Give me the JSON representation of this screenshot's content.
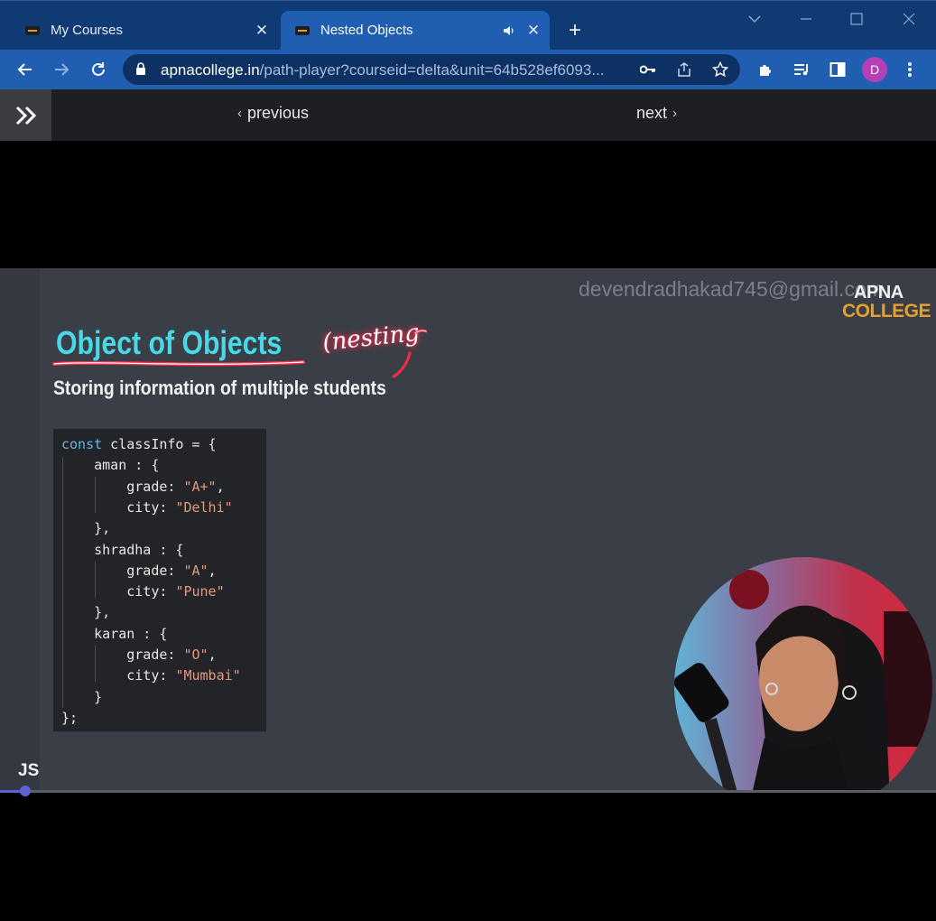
{
  "browser": {
    "tabs": [
      {
        "title": "My Courses",
        "active": false
      },
      {
        "title": "Nested Objects",
        "active": true
      }
    ],
    "url_host": "apnacollege.in",
    "url_rest": "/path-player?courseid=delta&unit=64b528ef6093...",
    "profile_initial": "D"
  },
  "nav": {
    "previous_label": "previous",
    "next_label": "next"
  },
  "slide": {
    "watermark": "devendradhakad745@gmail.com",
    "logo_top": "APNA",
    "logo_bottom": "COLLEGE",
    "title": "Object of Objects",
    "annotation": "(nesting",
    "subtitle": "Storing information of multiple students",
    "code_lines": [
      [
        {
          "t": "kw",
          "v": "const"
        },
        {
          "t": "p",
          "v": " classInfo = {"
        }
      ],
      [
        {
          "t": "p",
          "v": "    aman : {"
        }
      ],
      [
        {
          "t": "p",
          "v": "        grade: "
        },
        {
          "t": "str",
          "v": "\"A+\""
        },
        {
          "t": "p",
          "v": ","
        }
      ],
      [
        {
          "t": "p",
          "v": "        city: "
        },
        {
          "t": "str",
          "v": "\"Delhi\""
        }
      ],
      [
        {
          "t": "p",
          "v": "    },"
        }
      ],
      [
        {
          "t": "p",
          "v": "    shradha : {"
        }
      ],
      [
        {
          "t": "p",
          "v": "        grade: "
        },
        {
          "t": "str",
          "v": "\"A\""
        },
        {
          "t": "p",
          "v": ","
        }
      ],
      [
        {
          "t": "p",
          "v": "        city: "
        },
        {
          "t": "str",
          "v": "\"Pune\""
        }
      ],
      [
        {
          "t": "p",
          "v": "    },"
        }
      ],
      [
        {
          "t": "p",
          "v": "    karan : {"
        }
      ],
      [
        {
          "t": "p",
          "v": "        grade: "
        },
        {
          "t": "str",
          "v": "\"O\""
        },
        {
          "t": "p",
          "v": ","
        }
      ],
      [
        {
          "t": "p",
          "v": "        city: "
        },
        {
          "t": "str",
          "v": "\"Mumbai\""
        }
      ],
      [
        {
          "t": "p",
          "v": "    }"
        }
      ],
      [
        {
          "t": "p",
          "v": "};"
        }
      ]
    ],
    "section_label": "JS"
  },
  "player": {
    "progress_fraction": 0.027
  },
  "colors": {
    "tab_strip": "#0f3a73",
    "toolbar": "#1f5eb0",
    "title_cyan": "#48d8e6",
    "code_keyword": "#64b5e8",
    "code_string": "#e49a82",
    "progress": "#5b63d6"
  }
}
